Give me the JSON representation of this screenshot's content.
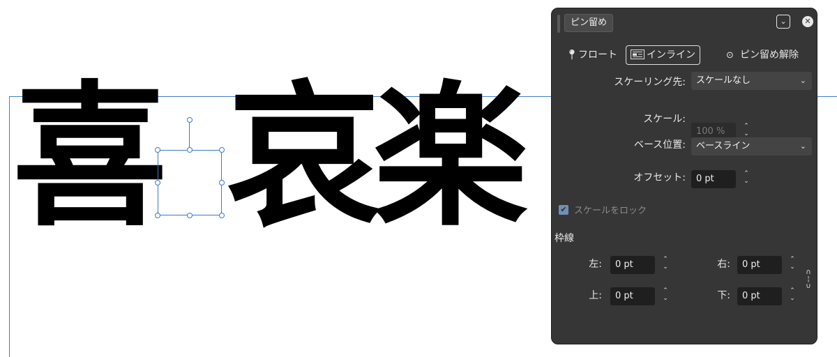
{
  "canvas": {
    "glyphs": [
      "喜",
      "哀",
      "楽"
    ],
    "frame_color": "#3d7fd6",
    "selection_color": "#3b79c9"
  },
  "panel": {
    "tab_label": "ピン留め",
    "collapse_icon": "chevron-down-icon",
    "close_icon": "close-icon",
    "modes": {
      "float_label": "フロート",
      "inline_label": "インライン",
      "unpin_label": "ピン留め解除"
    },
    "scale_to": {
      "label": "スケーリング先:",
      "value": "スケールなし"
    },
    "scale": {
      "label": "スケール:",
      "value": "100 %"
    },
    "base_position": {
      "label": "ベース位置:",
      "value": "ベースライン"
    },
    "offset": {
      "label": "オフセット:",
      "value": "0 pt"
    },
    "lock_scale": {
      "label": "スケールをロック",
      "checked": true
    },
    "border": {
      "section_label": "枠線",
      "left": {
        "label": "左:",
        "value": "0 pt"
      },
      "right": {
        "label": "右:",
        "value": "0 pt"
      },
      "top": {
        "label": "上:",
        "value": "0 pt"
      },
      "bottom": {
        "label": "下:",
        "value": "0 pt"
      }
    }
  }
}
